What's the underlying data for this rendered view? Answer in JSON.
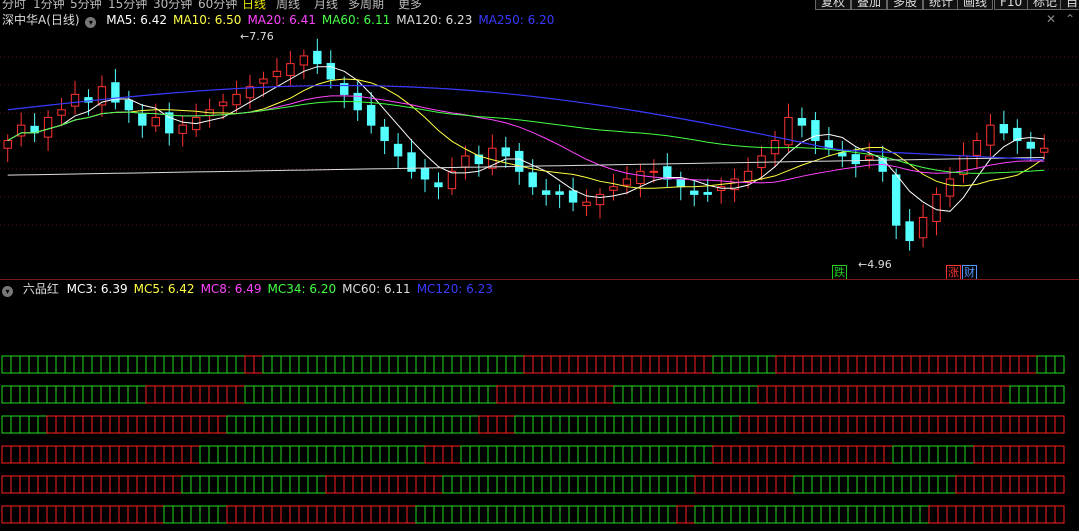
{
  "period_tabs": [
    "分时",
    "1分钟",
    "5分钟",
    "15分钟",
    "30分钟",
    "60分钟",
    "日线",
    "周线",
    "月线",
    "多周期",
    "更多"
  ],
  "active_period": "日线",
  "toolbar": [
    "复权",
    "叠加",
    "多股",
    "统计",
    "画线",
    "F10",
    "标记",
    "自"
  ],
  "main_indicator": {
    "title": "深中华A(日线)",
    "items": [
      {
        "label": "MA5: 6.42",
        "color": "#ffffff"
      },
      {
        "label": "MA10: 6.50",
        "color": "#ffff44"
      },
      {
        "label": "MA20: 6.41",
        "color": "#ff44ff"
      },
      {
        "label": "MA60: 6.11",
        "color": "#44ff44"
      },
      {
        "label": "MA120: 6.23",
        "color": "#dddddd"
      },
      {
        "label": "MA250: 6.20",
        "color": "#3a3aff"
      }
    ]
  },
  "sub_indicator": {
    "title": "六品红",
    "items": [
      {
        "label": "MC3: 6.39",
        "color": "#ffffff"
      },
      {
        "label": "MC5: 6.42",
        "color": "#ffff44"
      },
      {
        "label": "MC8: 6.49",
        "color": "#ff44ff"
      },
      {
        "label": "MC34: 6.20",
        "color": "#44ff44"
      },
      {
        "label": "MC60: 6.11",
        "color": "#dddddd"
      },
      {
        "label": "MC120: 6.23",
        "color": "#3a3aff"
      }
    ]
  },
  "price_annotations": {
    "high": "7.76",
    "low": "4.96"
  },
  "markers": [
    {
      "text": "跌",
      "color": "#22cc22"
    },
    {
      "text": "涨",
      "color": "#ff3333"
    },
    {
      "text": "财",
      "color": "#5599ff"
    }
  ],
  "colors": {
    "up": "#ff3232",
    "down": "#54ffff",
    "signal_up": "#ff2020",
    "signal_down": "#20dd20"
  },
  "chart_data": {
    "type": "candlestick",
    "low_point": 4.96,
    "high_point": 7.76,
    "closes": [
      6.5,
      6.7,
      6.6,
      6.8,
      6.9,
      7.1,
      7.0,
      7.2,
      7.0,
      6.9,
      6.7,
      6.8,
      6.6,
      6.7,
      6.8,
      6.9,
      7.0,
      7.1,
      7.2,
      7.3,
      7.4,
      7.5,
      7.6,
      7.5,
      7.3,
      7.1,
      6.9,
      6.7,
      6.5,
      6.3,
      6.1,
      6.0,
      5.9,
      6.1,
      6.3,
      6.2,
      6.4,
      6.3,
      6.1,
      5.9,
      5.8,
      5.8,
      5.7,
      5.7,
      5.8,
      5.9,
      6.0,
      6.1,
      6.1,
      6.0,
      5.9,
      5.8,
      5.8,
      5.9,
      6.0,
      6.1,
      6.3,
      6.5,
      6.8,
      6.7,
      6.5,
      6.4,
      6.3,
      6.2,
      6.3,
      6.1,
      5.4,
      5.2,
      5.5,
      5.8,
      6.0,
      6.3,
      6.5,
      6.7,
      6.6,
      6.5,
      6.4,
      6.4
    ]
  }
}
